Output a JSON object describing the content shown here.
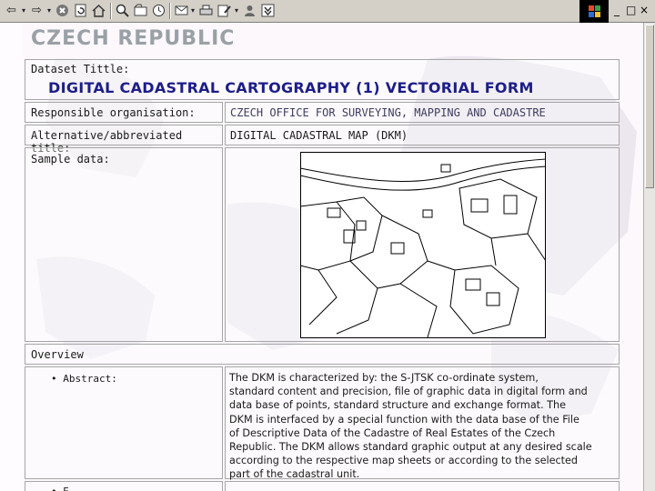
{
  "toolbar": {
    "icons": [
      "back-icon",
      "forward-icon",
      "stop-icon",
      "refresh-icon",
      "home-icon",
      "search-icon",
      "favorites-icon",
      "history-icon",
      "mail-icon",
      "print-icon",
      "edit-icon",
      "messenger-icon",
      "windows-update-icon"
    ],
    "window_controls": [
      "_",
      "□",
      "×"
    ]
  },
  "page": {
    "country": "CZECH REPUBLIC",
    "dataset_title_label": "Dataset Tittle:",
    "dataset_title": "DIGITAL CADASTRAL CARTOGRAPHY (1) VECTORIAL FORM",
    "responsible_label": "Responsible organisation:",
    "responsible_value": "CZECH OFFICE FOR SURVEYING, MAPPING AND CADASTRE",
    "alt_title_label": "Alternative/abbreviated title:",
    "alt_title_value": "DIGITAL CADASTRAL MAP (DKM)",
    "sample_label": "Sample data:",
    "overview_label": "Overview",
    "abstract_label": "Abstract:",
    "abstract_lines": [
      "The DKM is characterized by: the S-JTSK co-ordinate system,",
      "standard content and precision, file of graphic data in digital form and",
      "data base of points, standard structure and exchange format. The",
      "DKM is interfaced by a special function with the data base of the File",
      "of Descriptive Data of the Cadastre of Real Estates of the Czech",
      "Republic. The DKM allows standard graphic output at any desired scale",
      "according to the respective map sheets or according to the selected",
      "part of the cadastral unit."
    ],
    "next_bullet": "E"
  },
  "colors": {
    "toolbar_bg": "#d4d0c8",
    "title_blue": "#1d1d8a",
    "country_gray": "#9aa1a6",
    "border": "#a6a6a6"
  }
}
